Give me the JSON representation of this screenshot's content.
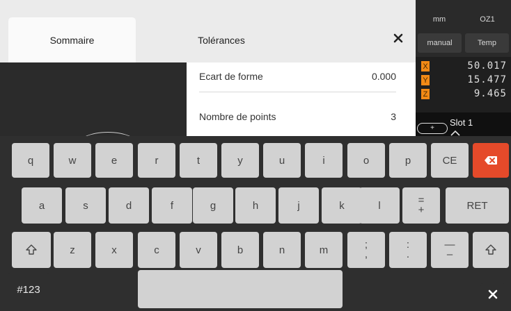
{
  "tabs": {
    "summary": "Sommaire",
    "tolerances": "Tolérances"
  },
  "list": {
    "items": [
      {
        "label": "Ecart de forme",
        "value": "0.000"
      },
      {
        "label": "Nombre de points",
        "value": "3"
      }
    ]
  },
  "dro": {
    "unit": "mm",
    "preset": "OZ1",
    "mode": "manual",
    "temp": "Temp",
    "axes": [
      {
        "name": "X",
        "value": "50.017"
      },
      {
        "name": "Y",
        "value": "15.477"
      },
      {
        "name": "Z",
        "value": "9.465"
      }
    ],
    "add_symbol": "+",
    "slot_label": "Slot 1"
  },
  "keyboard": {
    "row1": [
      "q",
      "w",
      "e",
      "r",
      "t",
      "y",
      "u",
      "i",
      "o",
      "p",
      "CE"
    ],
    "row2": [
      "a",
      "s",
      "d",
      "f",
      "g",
      "h",
      "j",
      "k",
      "l"
    ],
    "row2_plus_top": "=",
    "row2_plus_bottom": "+",
    "row2_return": "RET",
    "row3": [
      "z",
      "x",
      "c",
      "v",
      "b",
      "n",
      "m"
    ],
    "row3_semicolon_top": ";",
    "row3_semicolon_bottom": ",",
    "row3_colon_top": ":",
    "row3_colon_bottom": ".",
    "row3_dash_top": "—",
    "row3_dash_bottom": "–",
    "numeric_switch": "#123",
    "space": ""
  },
  "colors": {
    "accent_orange": "#f28a16",
    "delete_red": "#e54a2a",
    "keyboard_bg": "#2f2f2f",
    "key_bg": "#d2d2d2"
  },
  "icons": {
    "close_top": "close-icon",
    "backspace": "backspace-icon",
    "shift": "shift-icon",
    "keyboard_close": "close-icon"
  }
}
